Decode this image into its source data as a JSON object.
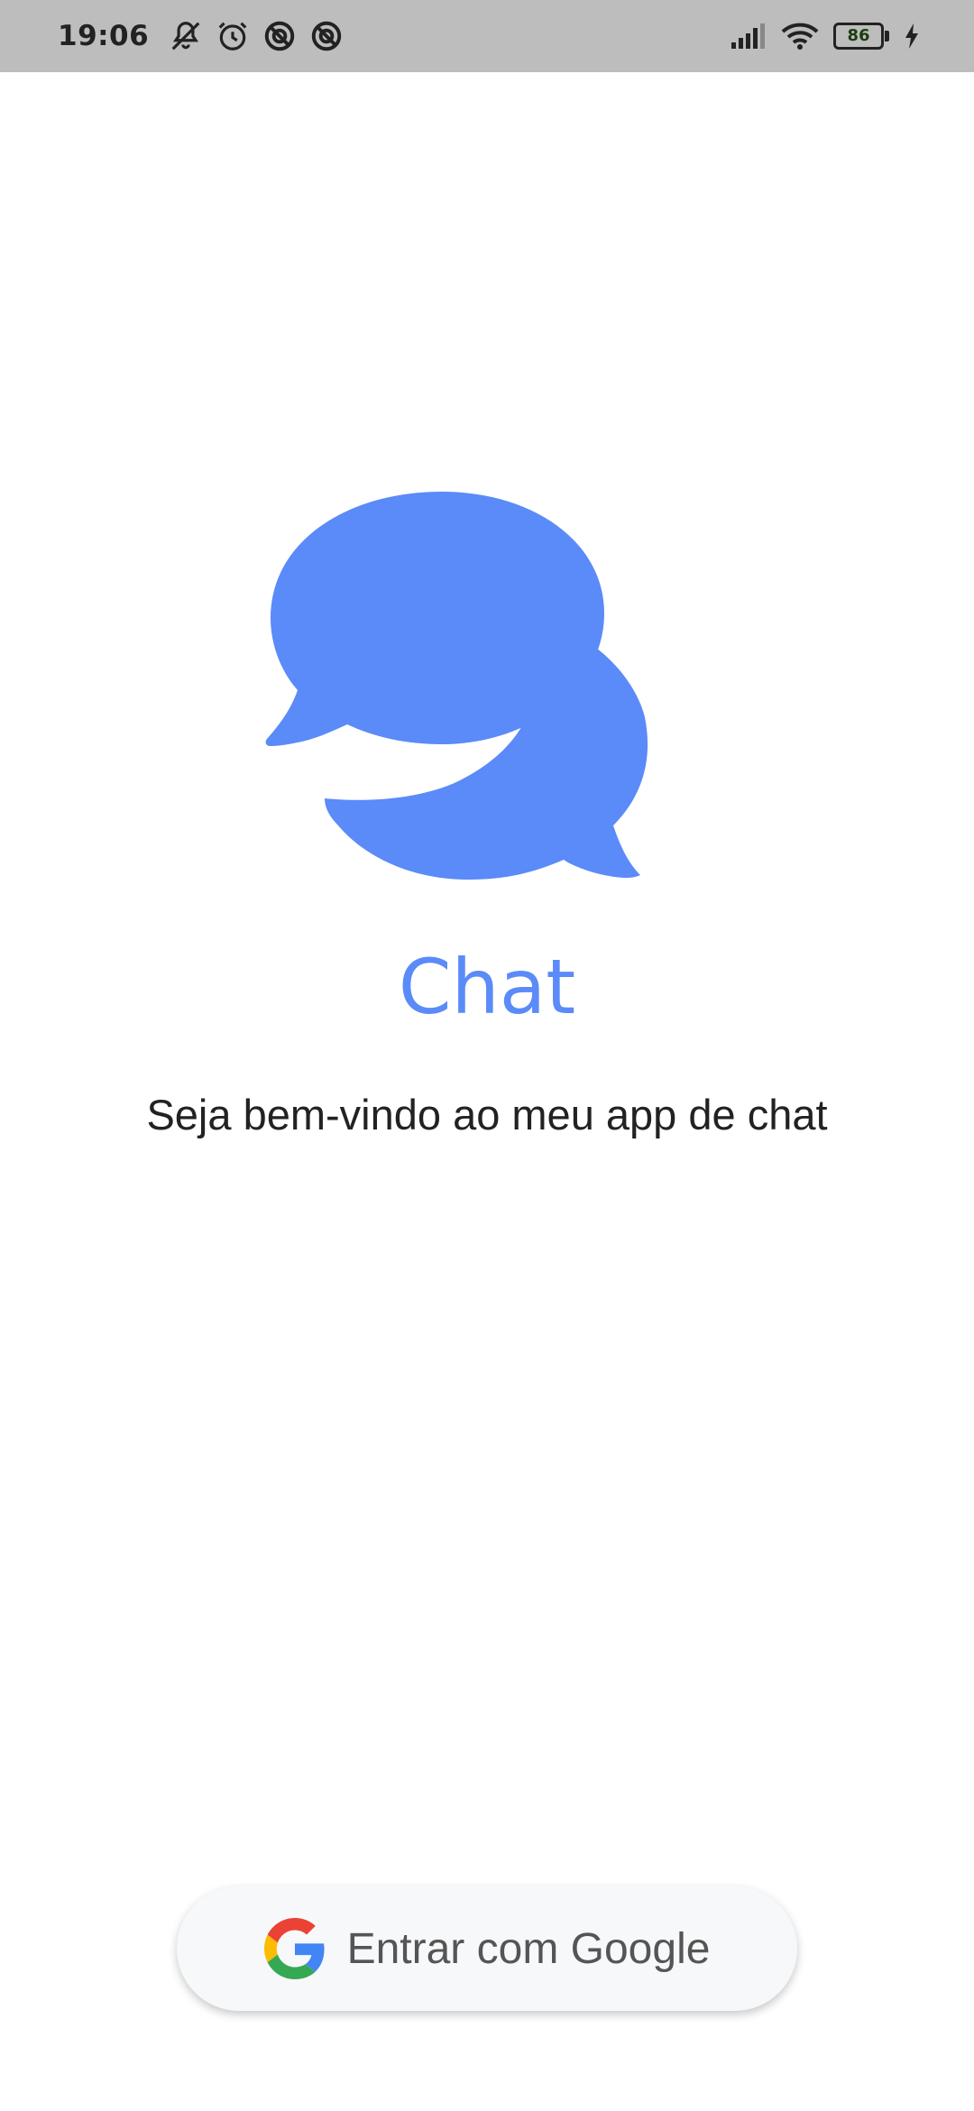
{
  "status_bar": {
    "time": "19:06",
    "battery_level": "86",
    "battery_percent": 86,
    "icons_left": [
      "notifications-muted-icon",
      "alarm-icon",
      "blocked-app-icon",
      "blocked-app-icon"
    ],
    "icons_right": [
      "signal-icon",
      "wifi-icon",
      "battery-icon",
      "charging-icon"
    ]
  },
  "app": {
    "title": "Chat",
    "subtitle": "Seja bem-vindo ao meu app de chat",
    "accent_color": "#5b8af9"
  },
  "login": {
    "google_button_label": "Entrar com Google"
  }
}
